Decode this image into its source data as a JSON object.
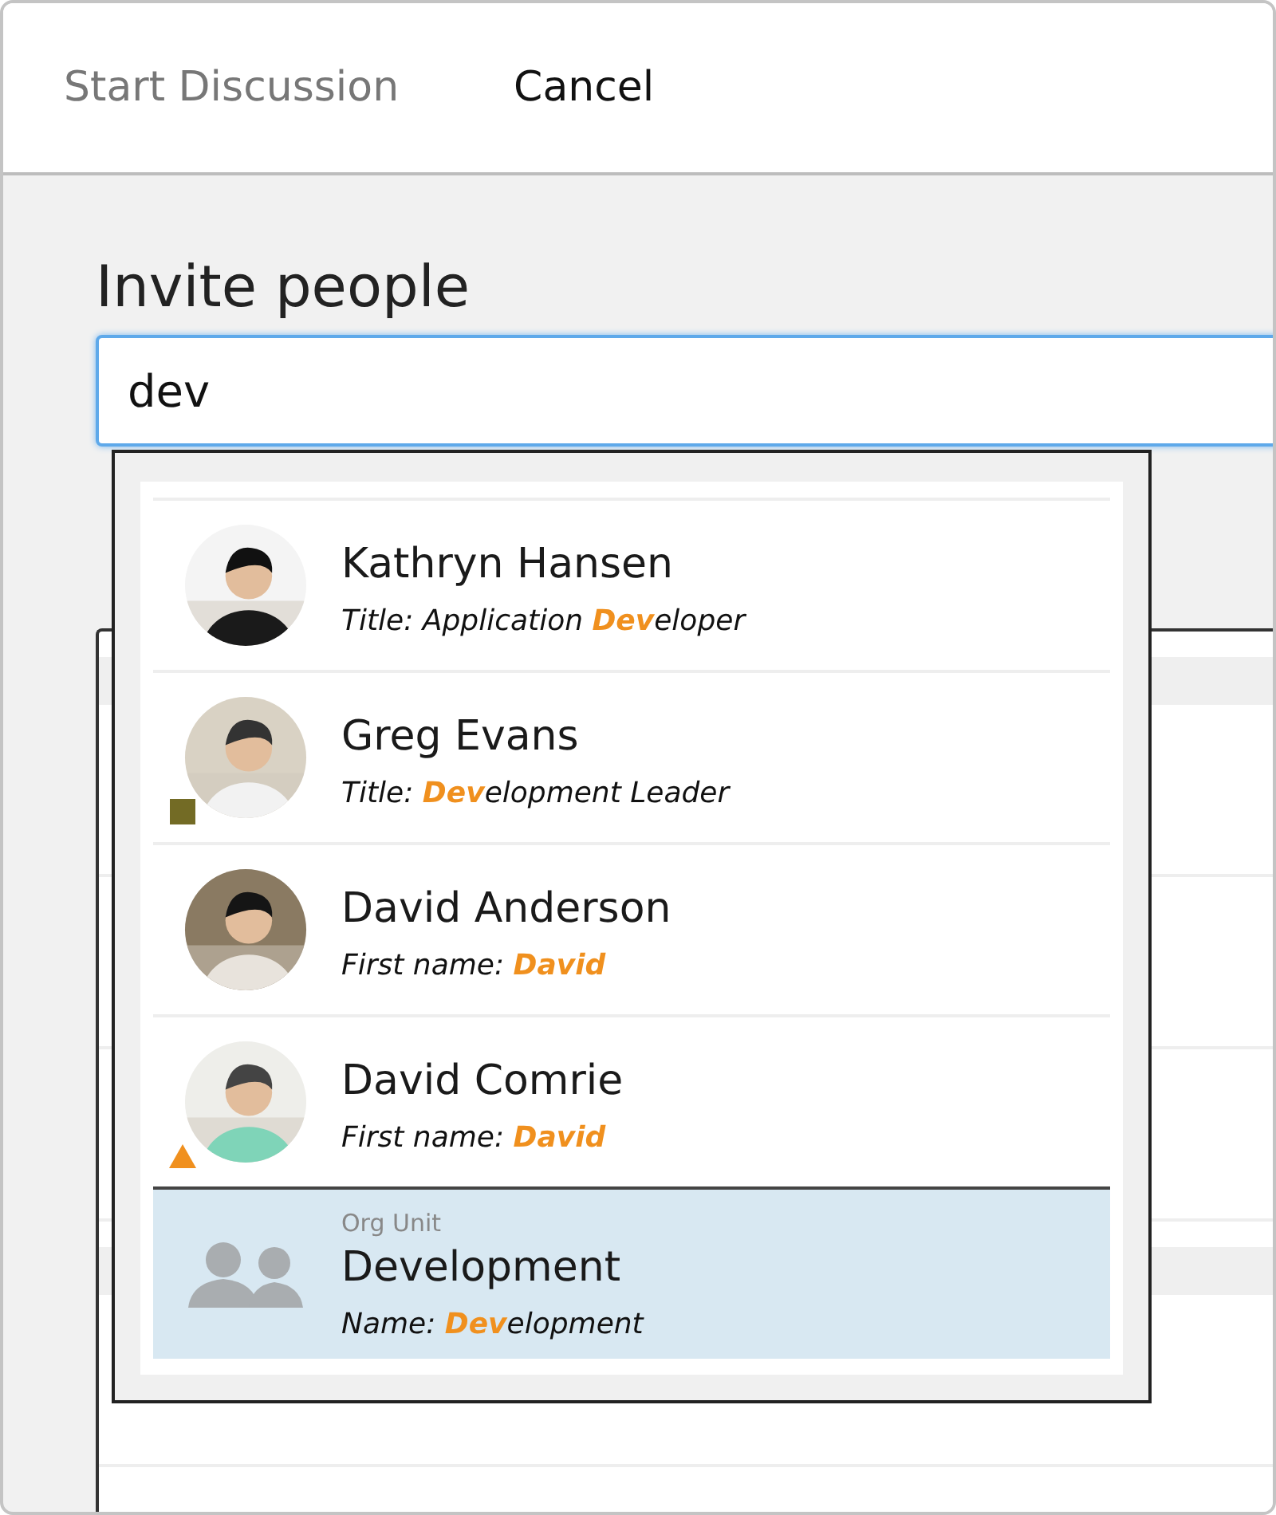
{
  "header": {
    "title": "Start Discussion",
    "cancel": "Cancel"
  },
  "invite": {
    "label": "Invite people",
    "value": "dev"
  },
  "suggestions": [
    {
      "kind": "person",
      "name": "Kathryn Hansen",
      "detail": "Title: Application **Dev**eloper",
      "selected": false
    },
    {
      "kind": "person",
      "name": "Greg Evans",
      "detail": "Title: **Dev**elopment Leader",
      "selected": false,
      "badge": {
        "kind": "square",
        "color": "#736b25"
      }
    },
    {
      "kind": "person",
      "name": "David Anderson",
      "detail": "First name: **David**",
      "selected": false
    },
    {
      "kind": "person",
      "name": "David Comrie",
      "detail": "First name: **David**",
      "selected": false,
      "badge": {
        "kind": "triangle",
        "color": "#f0901e"
      }
    },
    {
      "kind": "org_unit",
      "category": "Org Unit",
      "name": "Development",
      "detail": "Name: **Dev**elopment",
      "selected": true
    }
  ]
}
